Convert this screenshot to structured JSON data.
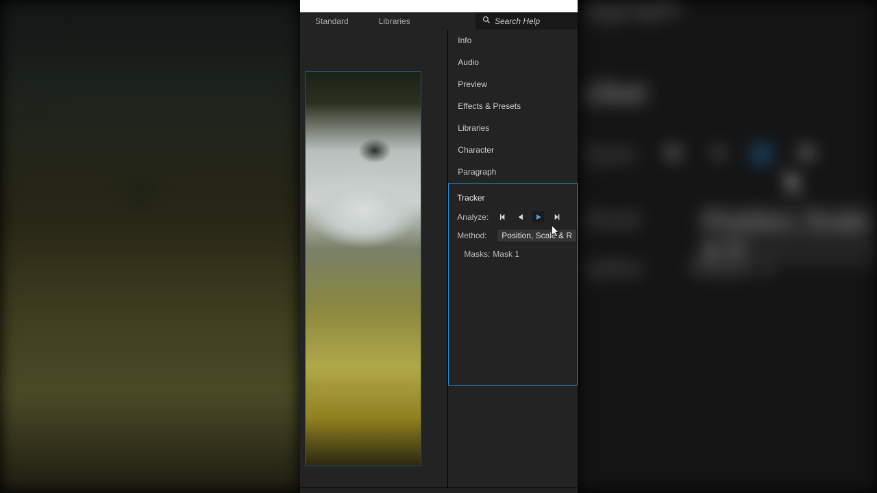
{
  "workspace": {
    "tab1": "Standard",
    "tab2": "Libraries"
  },
  "search": {
    "placeholder": "Search Help"
  },
  "panels": {
    "items": [
      "Info",
      "Audio",
      "Preview",
      "Effects & Presets",
      "Libraries",
      "Character",
      "Paragraph"
    ]
  },
  "tracker": {
    "title": "Tracker",
    "analyze_label": "Analyze:",
    "method_label": "Method:",
    "method_value": "Position, Scale & R",
    "masks_label": "Masks:",
    "masks_value": "Mask 1"
  },
  "bg": {
    "big_tracker": "cker",
    "big_paragraph": "agraph",
    "big_analyze": "lyze:",
    "big_method": "thod:",
    "big_method_val": "Position, Scale & R",
    "big_masks": "asks:",
    "big_masks_val": "Mask 1"
  }
}
